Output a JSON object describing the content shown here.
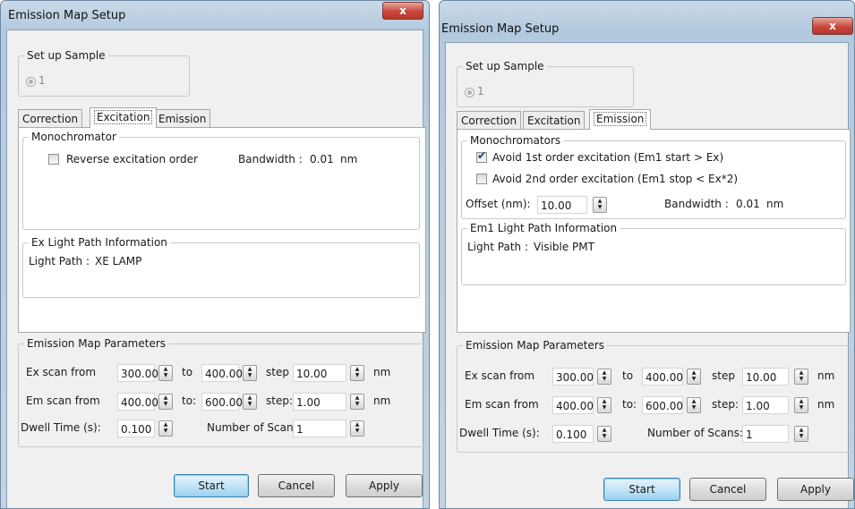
{
  "left": {
    "title": "Emission Map Setup",
    "close": "x",
    "sample": {
      "legend": "Set up Sample",
      "option": "1"
    },
    "tabs": [
      "Correction",
      "Excitation",
      "Emission"
    ],
    "active_tab": "Excitation",
    "mono": {
      "legend": "Monochromator",
      "reverse_label": "Reverse excitation order",
      "reverse_checked": false,
      "bandwidth_label": "Bandwidth :",
      "bandwidth_value": "0.01",
      "bandwidth_unit": "nm"
    },
    "path": {
      "legend": "Ex Light Path Information",
      "label": "Light Path :",
      "value": "XE LAMP"
    },
    "params": {
      "legend": "Emission Map Parameters",
      "ex_label": "Ex scan from",
      "ex_from": "300.00",
      "ex_to_label": "to",
      "ex_to": "400.00",
      "ex_step_label": "step",
      "ex_step": "10.00",
      "ex_unit": "nm",
      "em_label": "Em scan from",
      "em_from": "400.00",
      "em_to_label": "to:",
      "em_to": "600.00",
      "em_step_label": "step:",
      "em_step": "1.00",
      "em_unit": "nm",
      "dwell_label": "Dwell Time (s):",
      "dwell": "0.100",
      "scans_label": "Number of Scans:",
      "scans": "1"
    },
    "buttons": {
      "start": "Start",
      "cancel": "Cancel",
      "apply": "Apply"
    }
  },
  "right": {
    "title": "Emission Map Setup",
    "close": "x",
    "sample": {
      "legend": "Set up Sample",
      "option": "1"
    },
    "tabs": [
      "Correction",
      "Excitation",
      "Emission"
    ],
    "active_tab": "Emission",
    "mono": {
      "legend": "Monochromators",
      "avoid1_label": "Avoid 1st order excitation (Em1 start > Ex)",
      "avoid1_checked": true,
      "avoid2_label": "Avoid 2nd order excitation (Em1 stop < Ex*2)",
      "avoid2_checked": false,
      "offset_label": "Offset (nm):",
      "offset_value": "10.00",
      "bandwidth_label": "Bandwidth :",
      "bandwidth_value": "0.01",
      "bandwidth_unit": "nm"
    },
    "path": {
      "legend": "Em1 Light Path Information",
      "label": "Light Path :",
      "value": "Visible PMT"
    },
    "params": {
      "legend": "Emission Map Parameters",
      "ex_label": "Ex scan from",
      "ex_from": "300.00",
      "ex_to_label": "to",
      "ex_to": "400.00",
      "ex_step_label": "step",
      "ex_step": "10.00",
      "ex_unit": "nm",
      "em_label": "Em scan from",
      "em_from": "400.00",
      "em_to_label": "to:",
      "em_to": "600.00",
      "em_step_label": "step:",
      "em_step": "1.00",
      "em_unit": "nm",
      "dwell_label": "Dwell Time (s):",
      "dwell": "0.100",
      "scans_label": "Number of Scans:",
      "scans": "1"
    },
    "buttons": {
      "start": "Start",
      "cancel": "Cancel",
      "apply": "Apply"
    }
  }
}
